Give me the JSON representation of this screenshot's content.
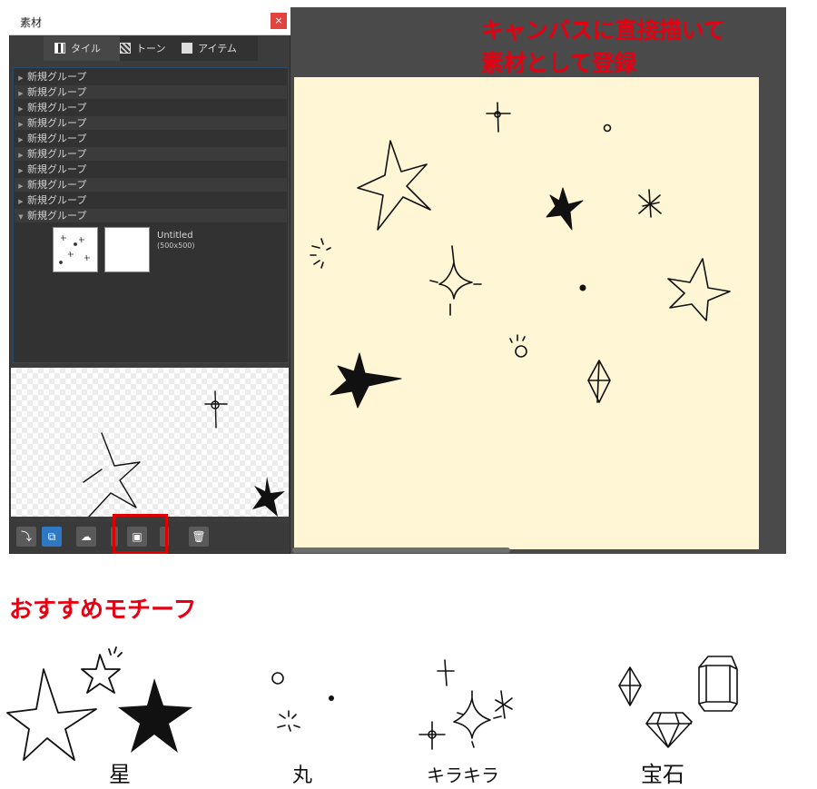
{
  "panel": {
    "title": "素材",
    "close_label": "×",
    "tabs": [
      {
        "label": "タイル",
        "icon": "checker-icon"
      },
      {
        "label": "トーン",
        "icon": "tone-icon"
      },
      {
        "label": "アイテム",
        "icon": "image-icon"
      }
    ],
    "tree": [
      {
        "label": "新規グループ",
        "expanded": false
      },
      {
        "label": "新規グループ",
        "expanded": false
      },
      {
        "label": "新規グループ",
        "expanded": false
      },
      {
        "label": "新規グループ",
        "expanded": false
      },
      {
        "label": "新規グループ",
        "expanded": false
      },
      {
        "label": "新規グループ",
        "expanded": false
      },
      {
        "label": "新規グループ",
        "expanded": false
      },
      {
        "label": "新規グループ",
        "expanded": false
      },
      {
        "label": "新規グループ",
        "expanded": false
      },
      {
        "label": "新規グループ",
        "expanded": true
      }
    ],
    "material_name": "Untitled",
    "material_size": "(500x500)"
  },
  "annotation": {
    "line1": "キャンバスに直接描いて",
    "line2": "素材として登録"
  },
  "recommend": {
    "heading": "おすすめモチーフ",
    "captions": [
      "星",
      "丸",
      "キラキラ",
      "宝石"
    ]
  },
  "colors": {
    "accent_red": "#e60012",
    "canvas_bg": "#fff6d5",
    "selected_tool": "#2f79c4"
  }
}
